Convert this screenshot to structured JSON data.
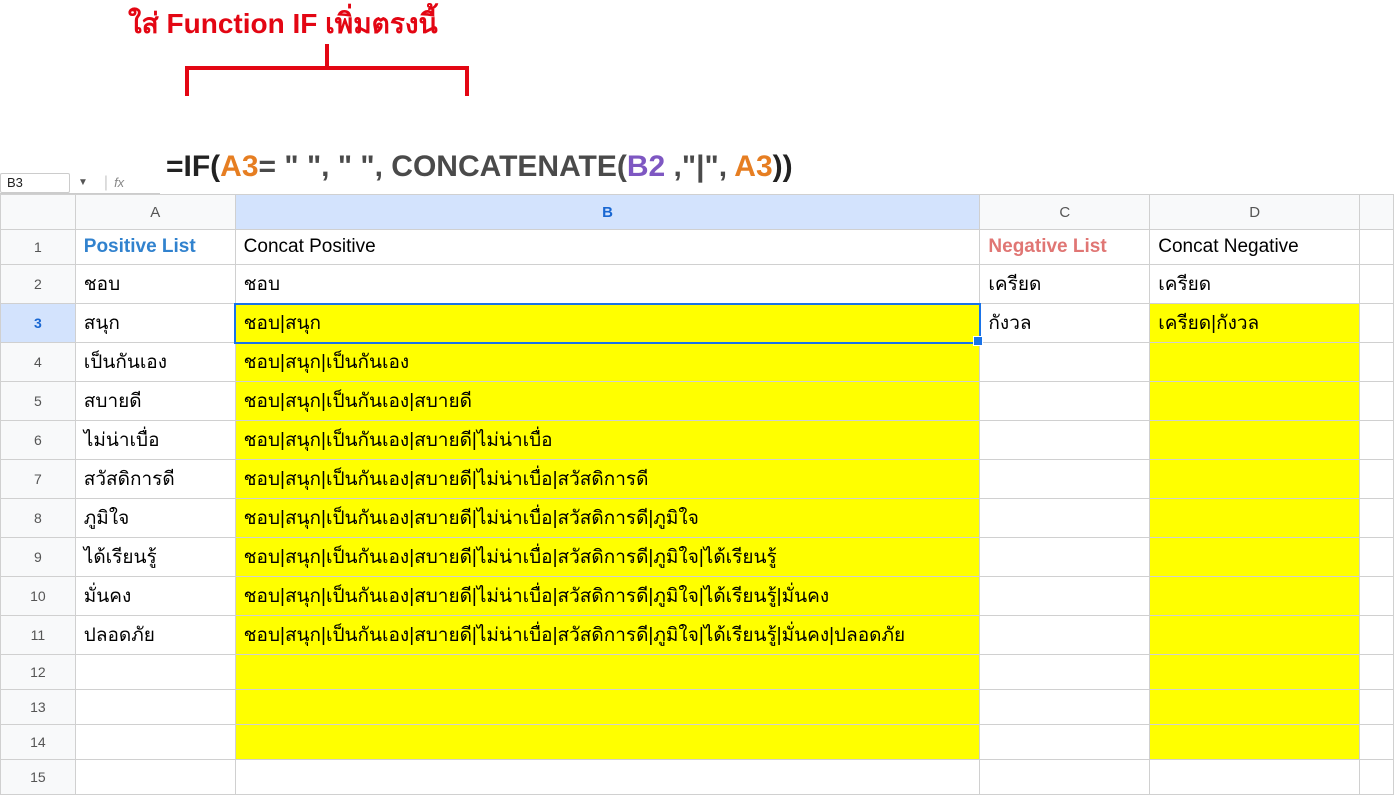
{
  "annotation": {
    "title": "ใส่ Function IF เพิ่มตรงนี้"
  },
  "formula": {
    "eq": "=IF(",
    "ref1": "A3",
    "part2": "= \" \", \" \", ",
    "concat": "CONCATENATE(",
    "ref2": "B2",
    "sep": " ,\"|\", ",
    "ref3": "A3",
    "end": "))"
  },
  "namebox": "B3",
  "fx": "fx",
  "columns": {
    "a": "A",
    "b": "B",
    "c": "C",
    "d": "D"
  },
  "headers": {
    "positive_list": "Positive List",
    "concat_positive": "Concat Positive",
    "negative_list": "Negative List",
    "concat_negative": "Concat Negative"
  },
  "rows": [
    {
      "n": "1"
    },
    {
      "n": "2",
      "a": "ชอบ",
      "b": "ชอบ",
      "c": "เครียด",
      "d": "เครียด"
    },
    {
      "n": "3",
      "a": "สนุก",
      "b": "ชอบ|สนุก",
      "c": "กังวล",
      "d": "เครียด|กังวล"
    },
    {
      "n": "4",
      "a": "เป็นกันเอง",
      "b": "ชอบ|สนุก|เป็นกันเอง",
      "c": "",
      "d": ""
    },
    {
      "n": "5",
      "a": "สบายดี",
      "b": "ชอบ|สนุก|เป็นกันเอง|สบายดี",
      "c": "",
      "d": ""
    },
    {
      "n": "6",
      "a": "ไม่น่าเบื่อ",
      "b": "ชอบ|สนุก|เป็นกันเอง|สบายดี|ไม่น่าเบื่อ",
      "c": "",
      "d": ""
    },
    {
      "n": "7",
      "a": "สวัสดิการดี",
      "b": "ชอบ|สนุก|เป็นกันเอง|สบายดี|ไม่น่าเบื่อ|สวัสดิการดี",
      "c": "",
      "d": ""
    },
    {
      "n": "8",
      "a": "ภูมิใจ",
      "b": "ชอบ|สนุก|เป็นกันเอง|สบายดี|ไม่น่าเบื่อ|สวัสดิการดี|ภูมิใจ",
      "c": "",
      "d": ""
    },
    {
      "n": "9",
      "a": "ได้เรียนรู้",
      "b": "ชอบ|สนุก|เป็นกันเอง|สบายดี|ไม่น่าเบื่อ|สวัสดิการดี|ภูมิใจ|ได้เรียนรู้",
      "c": "",
      "d": ""
    },
    {
      "n": "10",
      "a": "มั่นคง",
      "b": "ชอบ|สนุก|เป็นกันเอง|สบายดี|ไม่น่าเบื่อ|สวัสดิการดี|ภูมิใจ|ได้เรียนรู้|มั่นคง",
      "c": "",
      "d": ""
    },
    {
      "n": "11",
      "a": "ปลอดภัย",
      "b": "ชอบ|สนุก|เป็นกันเอง|สบายดี|ไม่น่าเบื่อ|สวัสดิการดี|ภูมิใจ|ได้เรียนรู้|มั่นคง|ปลอดภัย",
      "c": "",
      "d": ""
    },
    {
      "n": "12",
      "a": "",
      "b": "",
      "c": "",
      "d": ""
    },
    {
      "n": "13",
      "a": "",
      "b": "",
      "c": "",
      "d": ""
    },
    {
      "n": "14",
      "a": "",
      "b": "",
      "c": "",
      "d": ""
    },
    {
      "n": "15",
      "a": "",
      "b": "",
      "c": "",
      "d": ""
    }
  ]
}
